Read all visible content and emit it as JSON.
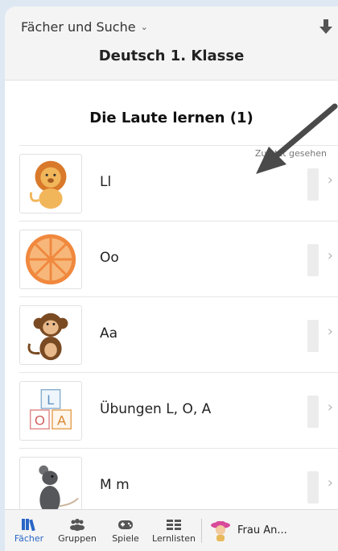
{
  "header": {
    "subject_menu": "Fächer und Suche",
    "title": "Deutsch 1. Klasse"
  },
  "section": {
    "title": "Die Laute lernen (1)",
    "recent_label": "Zuletzt gesehen"
  },
  "lessons": [
    {
      "label": "Ll",
      "image": "lion"
    },
    {
      "label": "Oo",
      "image": "orange"
    },
    {
      "label": "Aa",
      "image": "monkey"
    },
    {
      "label": "Übungen L, O, A",
      "image": "letter-blocks",
      "blocks": [
        "L",
        "O",
        "A"
      ]
    },
    {
      "label": "M m",
      "image": "mouse"
    }
  ],
  "tabbar": {
    "tabs": [
      "Fächer",
      "Gruppen",
      "Spiele",
      "Lernlisten"
    ],
    "active": "Fächer",
    "user": "Frau An..."
  },
  "colors": {
    "accent": "#2a65c7",
    "orange": "#f0883e",
    "lion": "#e09a3a"
  }
}
